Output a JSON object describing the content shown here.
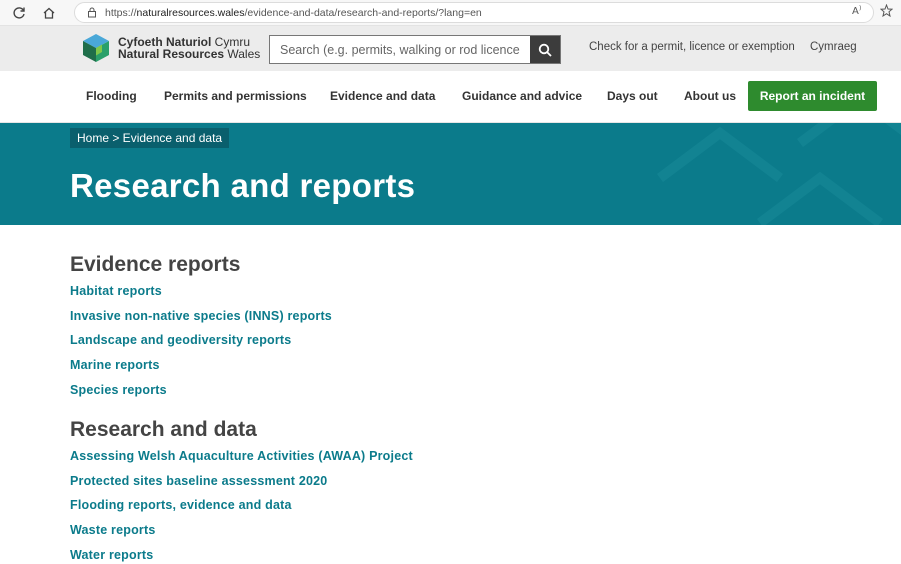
{
  "browser": {
    "url_prefix": "https://",
    "url_domain": "naturalresources.wales",
    "url_path": "/evidence-and-data/research-and-reports/?lang=en"
  },
  "header": {
    "logo_cy_bold": "Cyfoeth Naturiol",
    "logo_cy_rest": " Cymru",
    "logo_en_bold": "Natural Resources",
    "logo_en_rest": " Wales",
    "search_placeholder": "Search (e.g. permits, walking or rod licence",
    "check_link": "Check for a permit, licence or exemption",
    "language_link": "Cymraeg"
  },
  "nav": {
    "items": [
      "Flooding",
      "Permits and permissions",
      "Evidence and data",
      "Guidance and advice",
      "Days out",
      "About us"
    ],
    "report_button": "Report an incident"
  },
  "banner": {
    "breadcrumb": "Home > Evidence and data",
    "title": "Research and reports"
  },
  "sections": [
    {
      "heading": "Evidence reports",
      "links": [
        "Habitat reports",
        "Invasive non-native species (INNS) reports",
        "Landscape and geodiversity reports",
        "Marine reports",
        "Species reports"
      ]
    },
    {
      "heading": "Research and data",
      "links": [
        "Assessing Welsh Aquaculture Activities (AWAA) Project",
        "Protected sites baseline assessment 2020",
        "Flooding reports, evidence and data",
        "Waste reports",
        "Water reports"
      ]
    }
  ],
  "colors": {
    "teal": "#0b7b8b",
    "breadcrumb_bg": "#0a5f6d",
    "report_green": "#2e8b2e"
  }
}
